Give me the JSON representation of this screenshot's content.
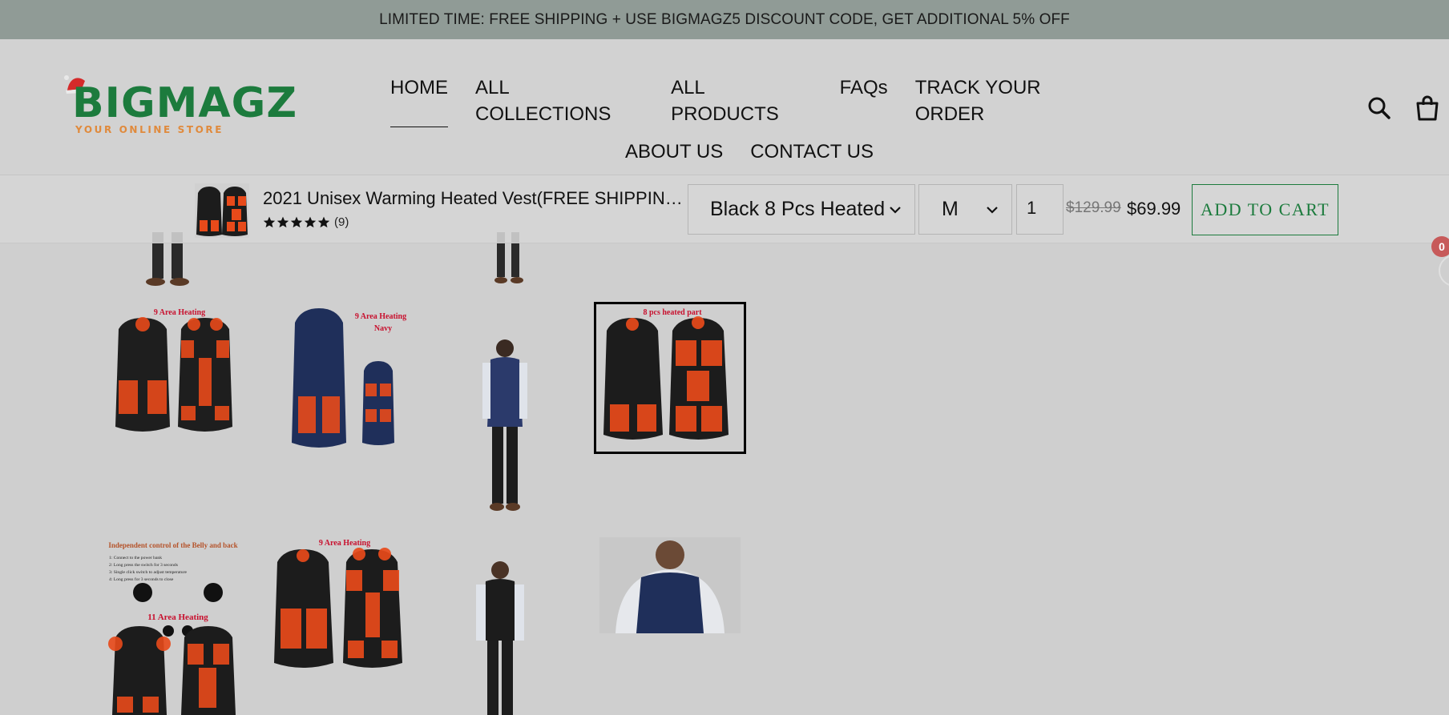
{
  "announcement": "LIMITED TIME: FREE SHIPPING + USE BIGMAGZ5 DISCOUNT CODE, GET ADDITIONAL 5% OFF",
  "logo": {
    "name": "BIGMAGZ",
    "tagline": "YOUR ONLINE STORE"
  },
  "nav": {
    "row1": [
      {
        "label": "HOME",
        "active": true
      },
      {
        "label": "ALL COLLECTIONS"
      },
      {
        "label": "ALL PRODUCTS"
      },
      {
        "label": "FAQs"
      },
      {
        "label": "TRACK YOUR ORDER"
      }
    ],
    "row2": [
      {
        "label": "ABOUT US"
      },
      {
        "label": "CONTACT US"
      }
    ]
  },
  "header_icons": [
    "search-icon",
    "cart-icon"
  ],
  "sticky_bar": {
    "title": "2021 Unisex Warming Heated Vest(FREE SHIPPIN…",
    "rating": 5,
    "reviews": "(9)",
    "variant": "Black 8 Pcs Heated",
    "size": "M",
    "quantity": "1",
    "compare_price": "$129.99",
    "price": "$69.99",
    "cta": "ADD TO CART"
  },
  "cart_badge": "0",
  "gallery": {
    "labels": {
      "nine_area": "9 Area Heating",
      "nine_area_navy_1": "9 Area Heating",
      "nine_area_navy_2": "Navy",
      "eight_pcs": "8 pcs heated part",
      "independent": "Independent control of the Belly and back",
      "eleven_area": "11 Area Heating",
      "nine_area_2": "9 Area Heating"
    },
    "steps": [
      "1: Connect to the power bank",
      "2: Long press the switch for 3 seconds",
      "3: Single click switch to adjust temperature",
      "4: Long press for 3 seconds to close"
    ]
  },
  "colors": {
    "brand_green": "#1c7b3d",
    "accent_orange": "#e08a3c",
    "announcement_bg": "#909b96",
    "heat": "#e84a1a"
  }
}
